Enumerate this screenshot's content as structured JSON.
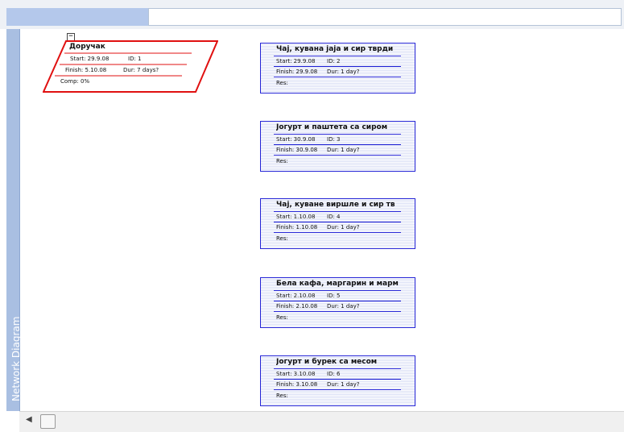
{
  "view_bar": {
    "label": "Network Diagram"
  },
  "collapse_symbol": "−",
  "summary": {
    "title": "Доручак",
    "start": "Start:  29.9.08",
    "id": "ID:   1",
    "finish": "Finish: 5.10.08",
    "dur": "Dur: 7 days?",
    "comp": "Comp: 0%"
  },
  "tasks": [
    {
      "title": "Чај, кувана јаја и сир тврди",
      "start": "Start:  29.9.08",
      "id": "ID:   2",
      "finish": "Finish: 29.9.08",
      "dur": "Dur: 1 day?",
      "res": "Res:"
    },
    {
      "title": "Јогурт и паштета са сиром",
      "start": "Start:  30.9.08",
      "id": "ID:   3",
      "finish": "Finish: 30.9.08",
      "dur": "Dur: 1 day?",
      "res": "Res:"
    },
    {
      "title": "Чај, куване виршле и сир тв",
      "start": "Start:  1.10.08",
      "id": "ID:   4",
      "finish": "Finish: 1.10.08",
      "dur": "Dur: 1 day?",
      "res": "Res:"
    },
    {
      "title": "Бела кафа, маргарин и марм",
      "start": "Start:  2.10.08",
      "id": "ID:   5",
      "finish": "Finish: 2.10.08",
      "dur": "Dur: 1 day?",
      "res": "Res:"
    },
    {
      "title": "Јогурт и бурек са месом",
      "start": "Start:  3.10.08",
      "id": "ID:   6",
      "finish": "Finish: 3.10.08",
      "dur": "Dur: 1 day?",
      "res": "Res:"
    }
  ],
  "scrollbar": {
    "left_arrow": "◀"
  },
  "colors": {
    "summary_border": "#e01010",
    "task_border": "#2424d6",
    "view_bar": "#a9bfe2"
  }
}
